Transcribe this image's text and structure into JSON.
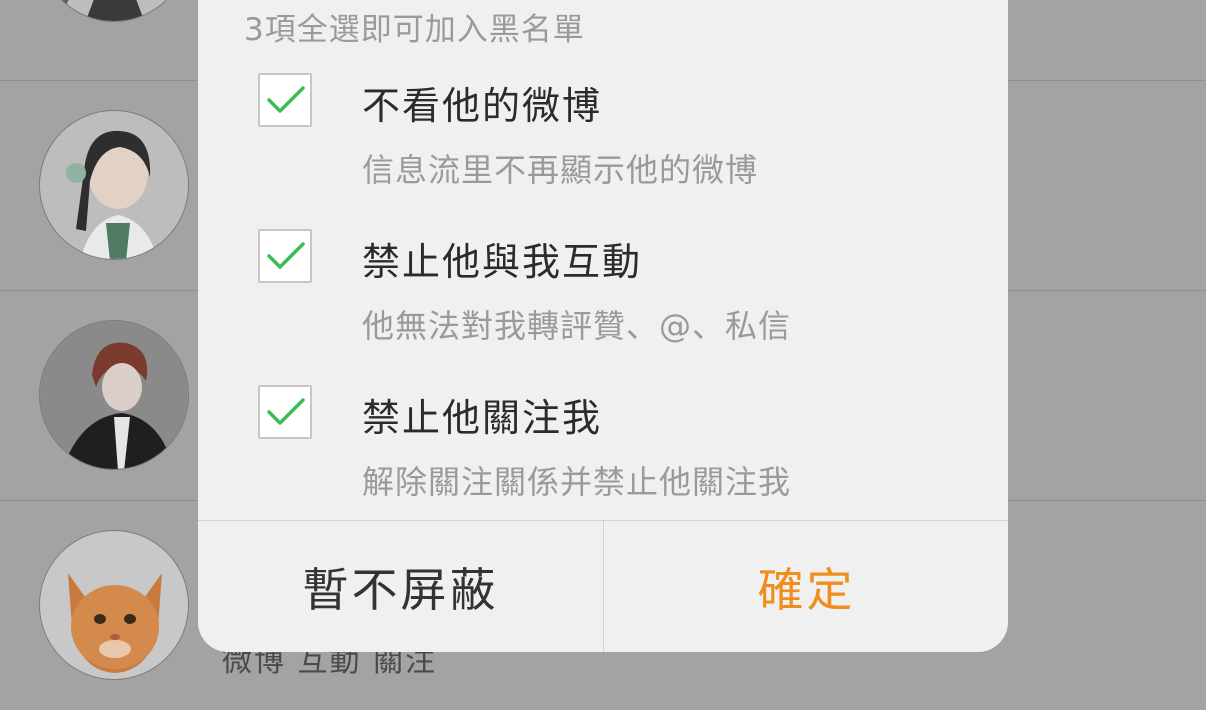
{
  "background_list": {
    "stats_text": "微博 互動 關注"
  },
  "dialog": {
    "header": "3項全選即可加入黑名單",
    "options": [
      {
        "title": "不看他的微博",
        "description": "信息流里不再顯示他的微博",
        "checked": true
      },
      {
        "title": "禁止他與我互動",
        "description": "他無法對我轉評贊、@、私信",
        "checked": true
      },
      {
        "title": "禁止他關注我",
        "description": "解除關注關係并禁止他關注我",
        "checked": true
      }
    ],
    "cancel_label": "暫不屏蔽",
    "confirm_label": "確定"
  },
  "colors": {
    "overlay_bg": "#a3a3a3",
    "dialog_bg": "#f0f0f0",
    "check_green": "#3dbb55",
    "confirm_orange": "#ef8e1c"
  }
}
